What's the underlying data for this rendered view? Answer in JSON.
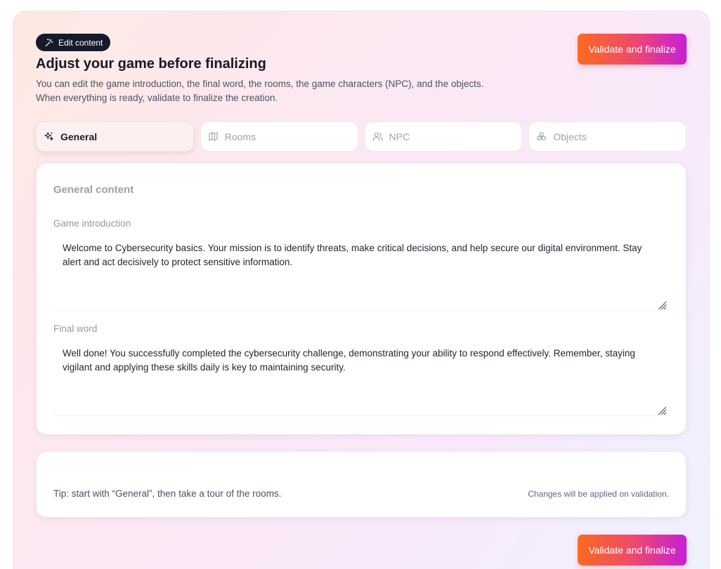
{
  "badge": {
    "label": "Edit content",
    "icon": "magic-wand-icon"
  },
  "header": {
    "title": "Adjust your game before finalizing",
    "description_line1": "You can edit the game introduction, the final word, the rooms, the game characters (NPC), and the objects.",
    "description_line2": "When everything is ready, validate to finalize the creation."
  },
  "actions": {
    "validate_label": "Validate and finalize"
  },
  "tabs": [
    {
      "label": "General",
      "icon": "sparkles-icon",
      "active": true
    },
    {
      "label": "Rooms",
      "icon": "map-icon",
      "active": false
    },
    {
      "label": "NPC",
      "icon": "users-icon",
      "active": false
    },
    {
      "label": "Objects",
      "icon": "boxes-icon",
      "active": false
    }
  ],
  "general": {
    "section_title": "General content",
    "intro_label": "Game introduction",
    "intro_value": "Welcome to Cybersecurity basics. Your mission is to identify threats, make critical decisions, and help secure our digital environment. Stay alert and act decisively to protect sensitive information.",
    "final_label": "Final word",
    "final_value": "Well done! You successfully completed the cybersecurity challenge, demonstrating your ability to respond effectively. Remember, staying vigilant and applying these skills daily is key to maintaining security."
  },
  "tip": {
    "text": "Tip: start with “General”, then take a tour of the rooms.",
    "note": "Changes will be applied on validation."
  },
  "colors": {
    "accent_start": "#fb6a1e",
    "accent_mid": "#ef4a6b",
    "accent_end": "#c71fd6",
    "badge_bg": "#161a2c"
  }
}
